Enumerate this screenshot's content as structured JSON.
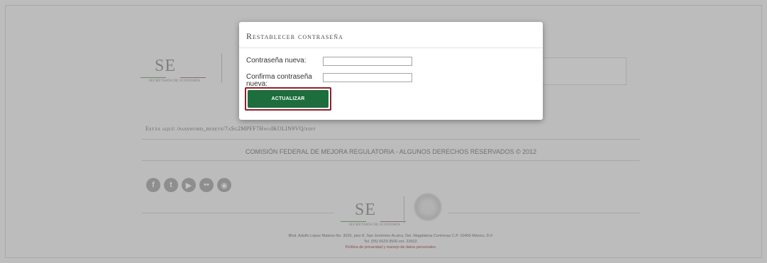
{
  "header": {
    "logo_letters": "SE",
    "logo_caption": "SECRETARÍA DE ECONOMÍA"
  },
  "breadcrumb": "Estás aquí: /password_resets/7aSg2MPFF7HwoIKOLIN9VQ/edit",
  "footer": {
    "copyright": "COMISIÓN FEDERAL DE MEJORA REGULATORIA - ALGUNOS DERECHOS RESERVADOS © 2012",
    "social_icons": [
      "facebook-icon",
      "twitter-icon",
      "youtube-icon",
      "flickr-icon",
      "rss-icon"
    ],
    "logo_letters": "SE",
    "logo_caption": "SECRETARÍA DE ECONOMÍA",
    "address_line1": "Blvd. Adolfo López Mateos No. 3025, piso 8, San Jerónimo Aculco, Del. Magdalena Contreras C.P. 10400 México, D.F.",
    "address_line2": "Tel. (55) 5629-9500 ext. 22602.",
    "privacy_link": "Política de privacidad y manejo de datos personales."
  },
  "modal": {
    "title": "Restablecer contraseña",
    "new_password_label": "Contraseña nueva:",
    "new_password_value": "",
    "confirm_password_label": "Confirma contraseña nueva:",
    "confirm_password_value": "",
    "submit_label": "ACTUALIZAR"
  },
  "colors": {
    "overlay_bg": "#bdbdbd",
    "button_green": "#1d6d3d",
    "highlight_border": "#8e1f2c"
  }
}
